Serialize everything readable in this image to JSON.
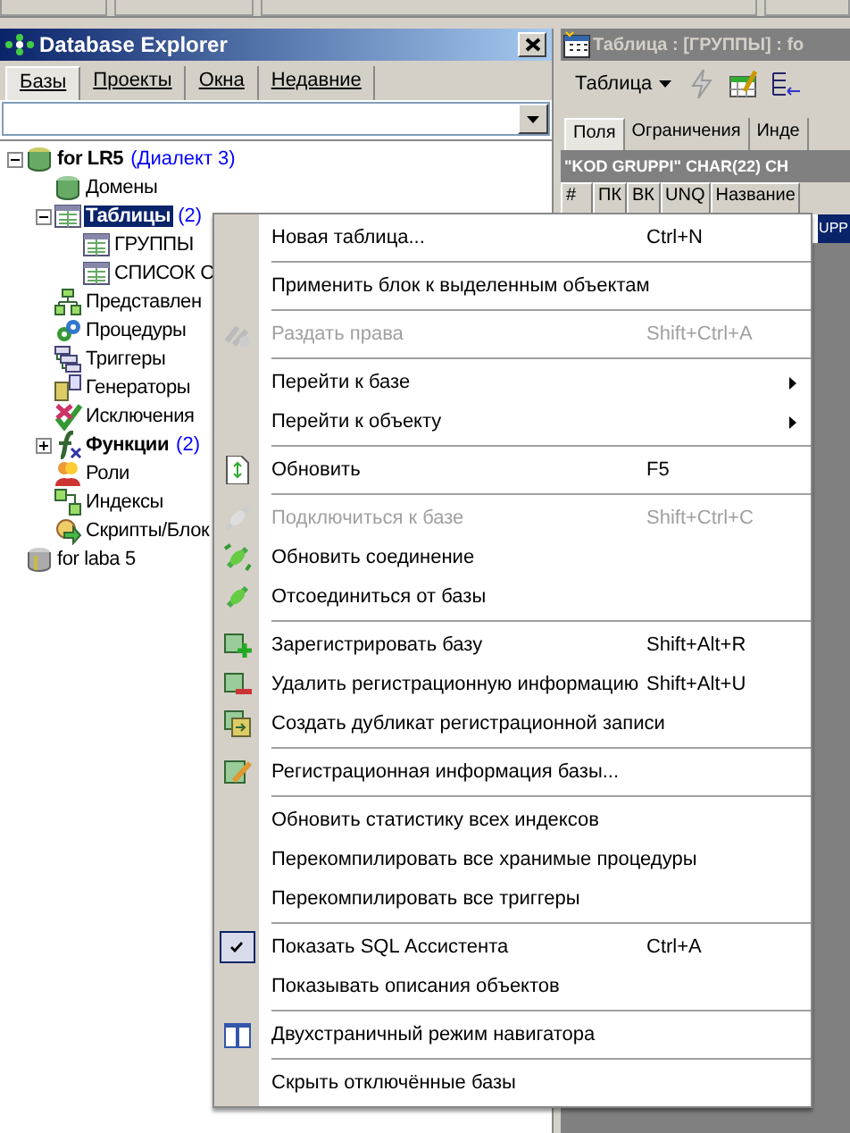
{
  "explorer": {
    "title": "Database Explorer",
    "tabs": [
      {
        "label": "Базы",
        "selected": true
      },
      {
        "label": "Проекты",
        "selected": false
      },
      {
        "label": "Окна",
        "selected": false
      },
      {
        "label": "Недавние",
        "selected": false
      }
    ],
    "tree": [
      {
        "label": "for LR5",
        "note": "(Диалект 3)",
        "bold": true,
        "selected": false,
        "expanded": true,
        "children": [
          {
            "label": "Домены",
            "bold": false,
            "selected": false
          },
          {
            "label": "Таблицы",
            "note": "(2)",
            "bold": true,
            "selected": true,
            "expanded": true,
            "children": [
              {
                "label": "ГРУППЫ",
                "bold": false,
                "selected": false
              },
              {
                "label": "СПИСОК С",
                "bold": false,
                "selected": false
              }
            ]
          },
          {
            "label": "Представлен",
            "bold": false,
            "selected": false
          },
          {
            "label": "Процедуры",
            "bold": false,
            "selected": false
          },
          {
            "label": "Триггеры",
            "bold": false,
            "selected": false
          },
          {
            "label": "Генераторы",
            "bold": false,
            "selected": false
          },
          {
            "label": "Исключения",
            "bold": false,
            "selected": false
          },
          {
            "label": "Функции",
            "note": "(2)",
            "bold": true,
            "selected": false,
            "expanded": false
          },
          {
            "label": "Роли",
            "bold": false,
            "selected": false
          },
          {
            "label": "Индексы",
            "bold": false,
            "selected": false
          },
          {
            "label": "Скрипты/Блок",
            "bold": false,
            "selected": false
          }
        ]
      },
      {
        "label": "for laba 5",
        "bold": false,
        "selected": false
      }
    ]
  },
  "table_window": {
    "title": "Таблица : [ГРУППЫ] : fo",
    "toolbar_menu": "Таблица",
    "tabs": [
      {
        "label": "Поля",
        "selected": true
      },
      {
        "label": "Ограничения",
        "selected": false
      },
      {
        "label": "Инде",
        "selected": false
      }
    ],
    "field_header": "\"KOD GRUPPI\" CHAR(22) CH",
    "columns": [
      "#",
      "ПК",
      "ВК",
      "UNQ",
      "Название"
    ],
    "row_fragment": "UPP"
  },
  "context_menu": [
    {
      "kind": "item",
      "label": "Новая таблица...",
      "shortcut": "Ctrl+N",
      "disabled": false,
      "submenu": false,
      "checked": false
    },
    {
      "kind": "separator"
    },
    {
      "kind": "item",
      "label": "Применить блок к выделенным объектам",
      "disabled": false,
      "submenu": false,
      "checked": false
    },
    {
      "kind": "separator"
    },
    {
      "kind": "item",
      "label": "Раздать права",
      "shortcut": "Shift+Ctrl+A",
      "disabled": true,
      "submenu": false,
      "checked": false
    },
    {
      "kind": "separator"
    },
    {
      "kind": "item",
      "label": "Перейти к базе",
      "disabled": false,
      "submenu": true,
      "checked": false
    },
    {
      "kind": "item",
      "label": "Перейти к объекту",
      "disabled": false,
      "submenu": true,
      "checked": false
    },
    {
      "kind": "separator"
    },
    {
      "kind": "item",
      "label": "Обновить",
      "shortcut": "F5",
      "disabled": false,
      "submenu": false,
      "checked": false
    },
    {
      "kind": "separator"
    },
    {
      "kind": "item",
      "label": "Подключиться к базе",
      "shortcut": "Shift+Ctrl+C",
      "disabled": true,
      "submenu": false,
      "checked": false
    },
    {
      "kind": "item",
      "label": "Обновить соединение",
      "disabled": false,
      "submenu": false,
      "checked": false
    },
    {
      "kind": "item",
      "label": "Отсоединиться от базы",
      "disabled": false,
      "submenu": false,
      "checked": false
    },
    {
      "kind": "separator"
    },
    {
      "kind": "item",
      "label": "Зарегистрировать базу",
      "shortcut": "Shift+Alt+R",
      "disabled": false,
      "submenu": false,
      "checked": false
    },
    {
      "kind": "item",
      "label": "Удалить регистрационную информацию",
      "shortcut": "Shift+Alt+U",
      "disabled": false,
      "submenu": false,
      "checked": false
    },
    {
      "kind": "item",
      "label": "Создать дубликат регистрационной записи",
      "disabled": false,
      "submenu": false,
      "checked": false
    },
    {
      "kind": "separator"
    },
    {
      "kind": "item",
      "label": "Регистрационная информация базы...",
      "disabled": false,
      "submenu": false,
      "checked": false
    },
    {
      "kind": "separator"
    },
    {
      "kind": "item",
      "label": "Обновить статистику всех индексов",
      "disabled": false,
      "submenu": false,
      "checked": false
    },
    {
      "kind": "item",
      "label": "Перекомпилировать все хранимые процедуры",
      "disabled": false,
      "submenu": false,
      "checked": false
    },
    {
      "kind": "item",
      "label": "Перекомпилировать все триггеры",
      "disabled": false,
      "submenu": false,
      "checked": false
    },
    {
      "kind": "separator"
    },
    {
      "kind": "item",
      "label": "Показать SQL Ассистента",
      "shortcut": "Ctrl+A",
      "disabled": false,
      "submenu": false,
      "checked": true
    },
    {
      "kind": "item",
      "label": "Показывать описания объектов",
      "disabled": false,
      "submenu": false,
      "checked": false
    },
    {
      "kind": "separator"
    },
    {
      "kind": "item",
      "label": "Двухстраничный режим навигатора",
      "disabled": false,
      "submenu": false,
      "checked": false
    },
    {
      "kind": "separator"
    },
    {
      "kind": "item",
      "label": "Скрыть отключённые базы",
      "disabled": false,
      "submenu": false,
      "checked": false
    }
  ]
}
